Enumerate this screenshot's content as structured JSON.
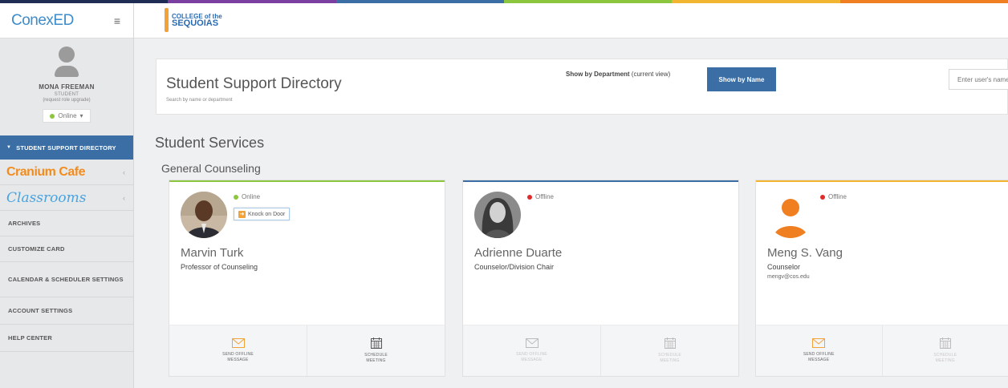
{
  "colors": {
    "rainbow": [
      "#1f2d55",
      "#7b3fa1",
      "#3a6ea5",
      "#8cc63f",
      "#f2b531",
      "#f07f22"
    ],
    "accent": "#3a6ea5",
    "online": "#8cc63f",
    "offline": "#e02b2b",
    "card_bars": [
      "#8cc63f",
      "#3a6ea5",
      "#f2b531"
    ]
  },
  "sidebar": {
    "brand": "ConexED",
    "menu_icon": "hamburger-icon",
    "profile": {
      "name": "MONA FREEMAN",
      "role": "STUDENT",
      "upgrade": "(request role upgrade)",
      "status": "Online"
    },
    "active_item": "STUDENT SUPPORT DIRECTORY",
    "cranium": "Cranium Cafe",
    "classrooms": "Classrooms",
    "items": [
      "ARCHIVES",
      "CUSTOMIZE CARD",
      "CALENDAR & SCHEDULER SETTINGS",
      "ACCOUNT SETTINGS",
      "HELP CENTER"
    ]
  },
  "topbar": {
    "logo_top": "COLLEGE of the",
    "logo_bottom": "SEQUOIAS"
  },
  "directory": {
    "title": "Student Support Directory",
    "subtitle": "Search by name or department",
    "dept_button_bold": "Show by Department",
    "dept_button_suffix": " (current view)",
    "name_button": "Show by Name",
    "search_placeholder": "Enter user's name"
  },
  "section_title": "Student Services",
  "group_title": "General Counseling",
  "cards": [
    {
      "name": "Marvin Turk",
      "title": "Professor of Counseling",
      "email": "",
      "status": "Online",
      "knock": "Knock on Door",
      "actions": [
        "SEND OFFLINE MESSAGE",
        "SCHEDULE MEETING"
      ]
    },
    {
      "name": "Adrienne Duarte",
      "title": "Counselor/Division Chair",
      "email": "",
      "status": "Offline",
      "actions": [
        "SEND OFFLINE MESSAGE",
        "SCHEDULE MEETING"
      ]
    },
    {
      "name": "Meng S. Vang",
      "title": "Counselor",
      "email": "mengv@cos.edu",
      "status": "Offline",
      "actions": [
        "SEND OFFLINE MESSAGE",
        "SCHEDULE MEETING"
      ]
    }
  ]
}
